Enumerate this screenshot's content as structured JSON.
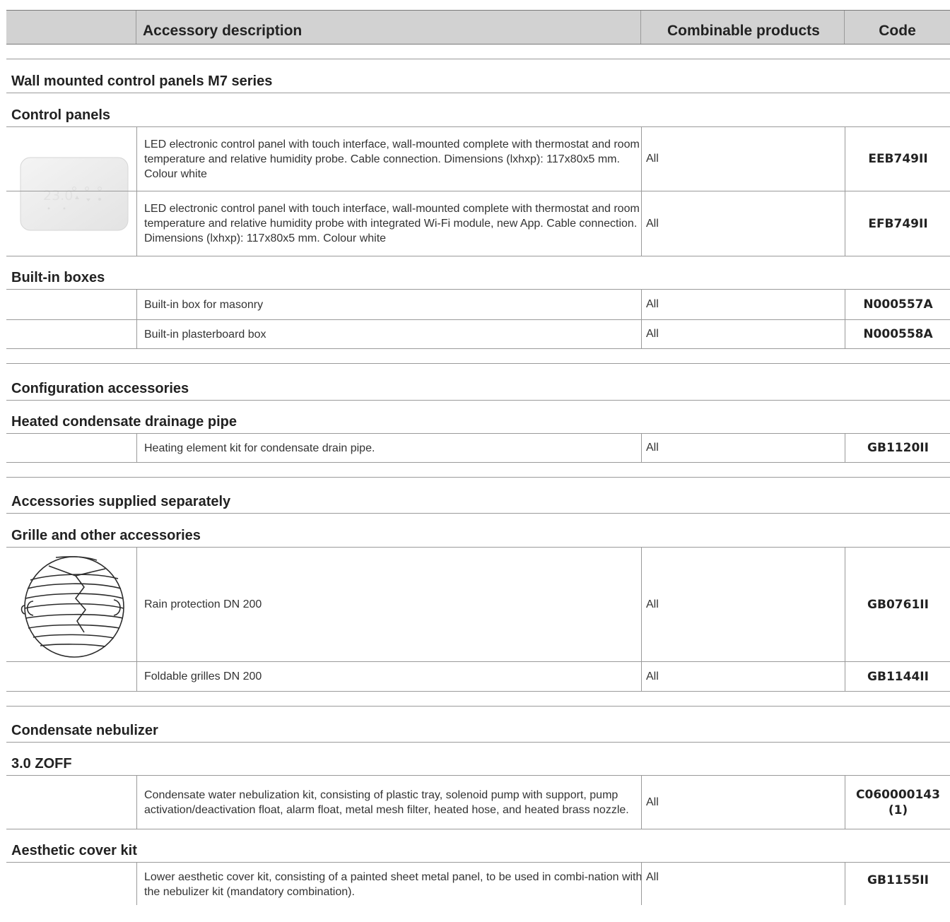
{
  "header": {
    "blank": "",
    "description": "Accessory description",
    "combinable": "Combinable products",
    "code": "Code"
  },
  "sections": {
    "wall_panels": "Wall mounted control panels M7 series",
    "control_panels": "Control panels",
    "builtin_boxes": "Built-in boxes",
    "configuration": "Configuration accessories",
    "heated_pipe": "Heated condensate drainage pipe",
    "supplied_separately": "Accessories supplied separately",
    "grille": "Grille and other accessories",
    "nebulizer": "Condensate nebulizer",
    "zoff": "3.0 ZOFF",
    "aesthetic": "Aesthetic cover kit"
  },
  "rows": [
    {
      "description": "LED electronic control panel with touch interface, wall-mounted complete with thermostat and room temperature and relative humidity probe. Cable connection. Dimensions (lxhxp): 117x80x5 mm. Colour white",
      "combinable": "All",
      "code": "EEB749II"
    },
    {
      "description": "LED electronic control panel with touch interface, wall-mounted complete with thermostat and room temperature and relative humidity probe with integrated Wi-Fi module, new App. Cable connection. Dimensions (lxhxp): 117x80x5 mm. Colour white",
      "combinable": "All",
      "code": "EFB749II"
    },
    {
      "description": "Built-in box for masonry",
      "combinable": "All",
      "code": "N000557A"
    },
    {
      "description": "Built-in plasterboard box",
      "combinable": "All",
      "code": "N000558A"
    },
    {
      "description": "Heating element kit for condensate drain pipe.",
      "combinable": "All",
      "code": "GB1120II"
    },
    {
      "description": "Rain protection DN 200",
      "combinable": "All",
      "code": "GB0761II"
    },
    {
      "description": "Foldable grilles DN 200",
      "combinable": "All",
      "code": "GB1144II"
    },
    {
      "description": "Condensate water nebulization kit, consisting of plastic tray, solenoid pump with support, pump activation/deactivation float, alarm float, metal mesh filter, heated hose, and heated brass nozzle.",
      "combinable": "All",
      "code": "C060000143 (1)"
    },
    {
      "description": "Lower aesthetic cover kit, consisting of a painted sheet metal panel, to be used in combi-nation with the nebulizer kit (mandatory combination).",
      "combinable": "All",
      "code": "GB1155II"
    }
  ],
  "images": {
    "thermostat_display": "23.0"
  }
}
